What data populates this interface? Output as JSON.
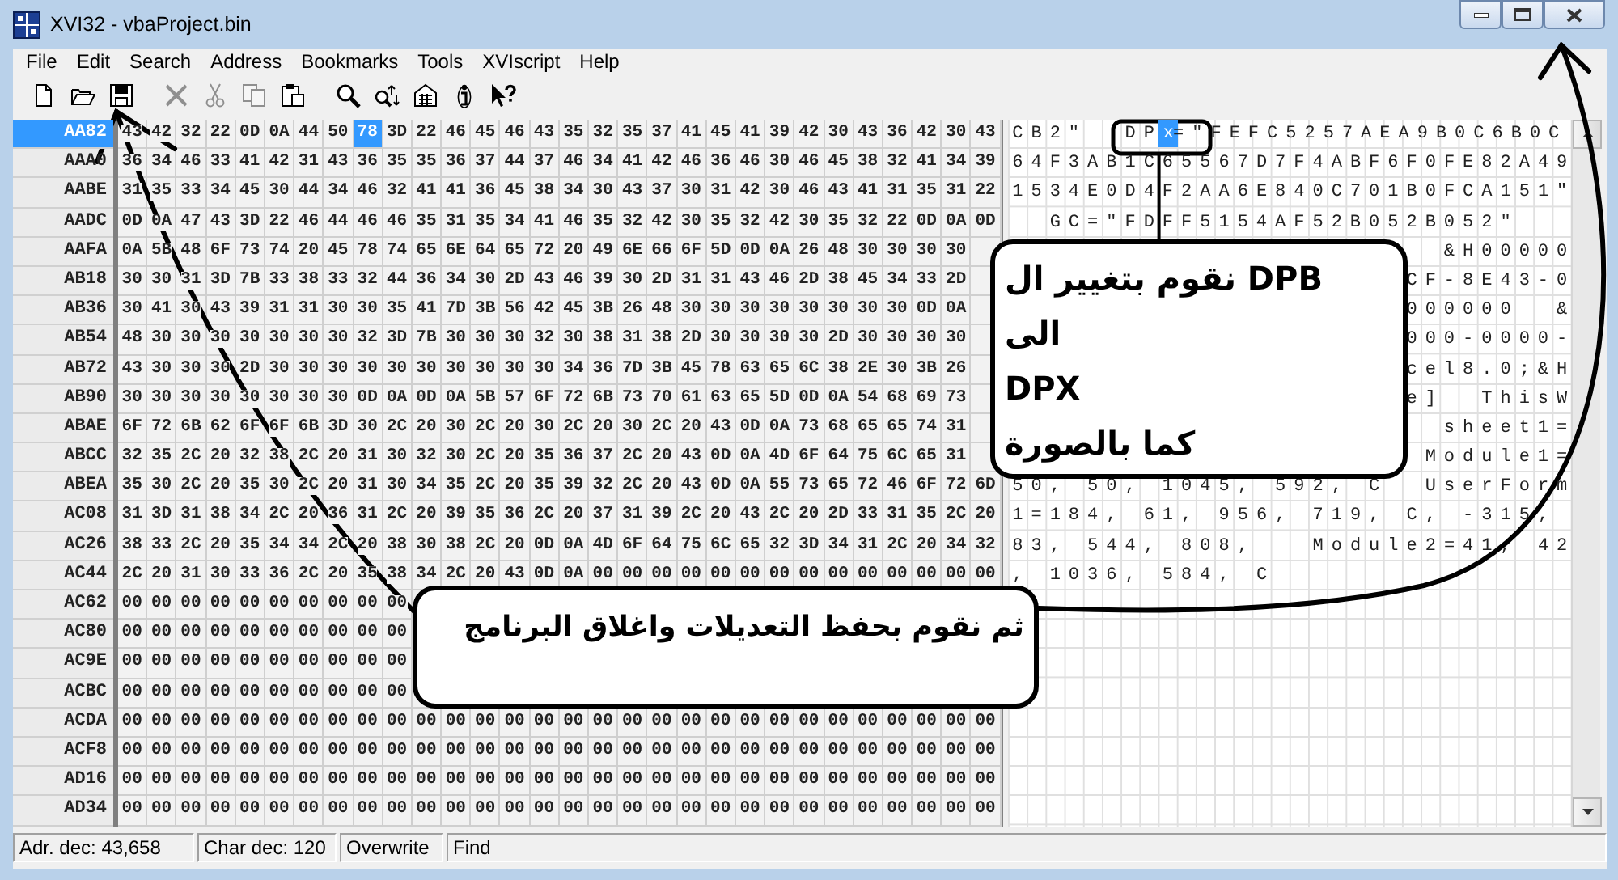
{
  "window": {
    "title": "XVI32 - vbaProject.bin"
  },
  "menu": [
    "File",
    "Edit",
    "Search",
    "Address",
    "Bookmarks",
    "Tools",
    "XVIscript",
    "Help"
  ],
  "toolbar": [
    {
      "kind": "new",
      "disabled": false
    },
    {
      "kind": "open",
      "disabled": false
    },
    {
      "kind": "save",
      "disabled": false
    },
    {
      "kind": "delete",
      "disabled": true
    },
    {
      "kind": "cut",
      "disabled": true
    },
    {
      "kind": "copy",
      "disabled": true
    },
    {
      "kind": "paste",
      "disabled": false
    },
    {
      "kind": "find",
      "disabled": false
    },
    {
      "kind": "replace",
      "disabled": false
    },
    {
      "kind": "properties",
      "disabled": false
    },
    {
      "kind": "info",
      "disabled": false
    },
    {
      "kind": "help",
      "disabled": false
    }
  ],
  "rows": [
    {
      "address": "AA82",
      "selected": true,
      "bytes": [
        "43",
        "42",
        "32",
        "22",
        "0D",
        "0A",
        "44",
        "50"
      ],
      "cursor": {
        "hex": "78",
        "char": "x"
      },
      "bytes_after": [
        "3D",
        "22",
        "46",
        "45",
        "46",
        "43",
        "35",
        "32",
        "35",
        "37",
        "41",
        "45",
        "41",
        "39",
        "42",
        "30",
        "43",
        "36",
        "42",
        "30",
        "43"
      ],
      "text": "CB2\"  DP",
      "text_after": "=\"FEFC5257AEA9B0C6B0C"
    },
    {
      "address": "AAA0",
      "selected": false,
      "bytes": [
        "36",
        "34",
        "46",
        "33",
        "41",
        "42",
        "31",
        "43",
        "36",
        "35",
        "35",
        "36",
        "37",
        "44",
        "37",
        "46",
        "34",
        "41",
        "42",
        "46",
        "36",
        "46",
        "30",
        "46",
        "45",
        "38",
        "32",
        "41",
        "34",
        "39"
      ],
      "text": "64F3AB1C65567D7F4ABF6F0FE82A49"
    },
    {
      "address": "AABE",
      "selected": false,
      "bytes": [
        "31",
        "35",
        "33",
        "34",
        "45",
        "30",
        "44",
        "34",
        "46",
        "32",
        "41",
        "41",
        "36",
        "45",
        "38",
        "34",
        "30",
        "43",
        "37",
        "30",
        "31",
        "42",
        "30",
        "46",
        "43",
        "41",
        "31",
        "35",
        "31",
        "22"
      ],
      "text": "1534E0D4F2AA6E840C701B0FCA151\""
    },
    {
      "address": "AADC",
      "selected": false,
      "bytes": [
        "0D",
        "0A",
        "47",
        "43",
        "3D",
        "22",
        "46",
        "44",
        "46",
        "46",
        "35",
        "31",
        "35",
        "34",
        "41",
        "46",
        "35",
        "32",
        "42",
        "30",
        "35",
        "32",
        "42",
        "30",
        "35",
        "32",
        "22",
        "0D",
        "0A",
        "0D"
      ],
      "text": "  GC=\"FDFF5154AF52B052B052\"   "
    },
    {
      "address": "AAFA",
      "selected": false,
      "bytes": [
        "0A",
        "5B",
        "48",
        "6F",
        "73",
        "74",
        "20",
        "45",
        "78",
        "74",
        "65",
        "6E",
        "64",
        "65",
        "72",
        "20",
        "49",
        "6E",
        "66",
        "6F",
        "5D",
        "0D",
        "0A",
        "26",
        "48",
        "30",
        "30",
        "30",
        "30"
      ],
      "text": "                       &H00000"
    },
    {
      "address": "AB18",
      "selected": false,
      "bytes": [
        "30",
        "30",
        "31",
        "3D",
        "7B",
        "33",
        "38",
        "33",
        "32",
        "44",
        "36",
        "34",
        "30",
        "2D",
        "43",
        "46",
        "39",
        "30",
        "2D",
        "31",
        "31",
        "43",
        "46",
        "2D",
        "38",
        "45",
        "34",
        "33",
        "2D"
      ],
      "text": "                     CF-8E43-0"
    },
    {
      "address": "AB36",
      "selected": false,
      "bytes": [
        "30",
        "41",
        "30",
        "43",
        "39",
        "31",
        "31",
        "30",
        "30",
        "35",
        "41",
        "7D",
        "3B",
        "56",
        "42",
        "45",
        "3B",
        "26",
        "48",
        "30",
        "30",
        "30",
        "30",
        "30",
        "30",
        "30",
        "30",
        "0D",
        "0A"
      ],
      "text": "                     000000  &"
    },
    {
      "address": "AB54",
      "selected": false,
      "bytes": [
        "48",
        "30",
        "30",
        "30",
        "30",
        "30",
        "30",
        "30",
        "32",
        "3D",
        "7B",
        "30",
        "30",
        "30",
        "32",
        "30",
        "38",
        "31",
        "38",
        "2D",
        "30",
        "30",
        "30",
        "30",
        "2D",
        "30",
        "30",
        "30",
        "30"
      ],
      "text": "                     000-0000-"
    },
    {
      "address": "AB72",
      "selected": false,
      "bytes": [
        "43",
        "30",
        "30",
        "30",
        "2D",
        "30",
        "30",
        "30",
        "30",
        "30",
        "30",
        "30",
        "30",
        "30",
        "30",
        "34",
        "36",
        "7D",
        "3B",
        "45",
        "78",
        "63",
        "65",
        "6C",
        "38",
        "2E",
        "30",
        "3B",
        "26"
      ],
      "text": "                     cel8.0;&H"
    },
    {
      "address": "AB90",
      "selected": false,
      "bytes": [
        "30",
        "30",
        "30",
        "30",
        "30",
        "30",
        "30",
        "30",
        "0D",
        "0A",
        "0D",
        "0A",
        "5B",
        "57",
        "6F",
        "72",
        "6B",
        "73",
        "70",
        "61",
        "63",
        "65",
        "5D",
        "0D",
        "0A",
        "54",
        "68",
        "69",
        "73"
      ],
      "text": "                     e]  ThisW"
    },
    {
      "address": "ABAE",
      "selected": false,
      "bytes": [
        "6F",
        "72",
        "6B",
        "62",
        "6F",
        "6F",
        "6B",
        "3D",
        "30",
        "2C",
        "20",
        "30",
        "2C",
        "20",
        "30",
        "2C",
        "20",
        "30",
        "2C",
        "20",
        "43",
        "0D",
        "0A",
        "73",
        "68",
        "65",
        "65",
        "74",
        "31"
      ],
      "text": "                       sheet1="
    },
    {
      "address": "ABCC",
      "selected": false,
      "bytes": [
        "32",
        "35",
        "2C",
        "20",
        "32",
        "38",
        "2C",
        "20",
        "31",
        "30",
        "32",
        "30",
        "2C",
        "20",
        "35",
        "36",
        "37",
        "2C",
        "20",
        "43",
        "0D",
        "0A",
        "4D",
        "6F",
        "64",
        "75",
        "6C",
        "65",
        "31"
      ],
      "text": "                      Module1="
    },
    {
      "address": "ABEA",
      "selected": false,
      "bytes": [
        "35",
        "30",
        "2C",
        "20",
        "35",
        "30",
        "2C",
        "20",
        "31",
        "30",
        "34",
        "35",
        "2C",
        "20",
        "35",
        "39",
        "32",
        "2C",
        "20",
        "43",
        "0D",
        "0A",
        "55",
        "73",
        "65",
        "72",
        "46",
        "6F",
        "72",
        "6D"
      ],
      "text": "50, 50, 1045, 592, C  UserForm"
    },
    {
      "address": "AC08",
      "selected": false,
      "bytes": [
        "31",
        "3D",
        "31",
        "38",
        "34",
        "2C",
        "20",
        "36",
        "31",
        "2C",
        "20",
        "39",
        "35",
        "36",
        "2C",
        "20",
        "37",
        "31",
        "39",
        "2C",
        "20",
        "43",
        "2C",
        "20",
        "2D",
        "33",
        "31",
        "35",
        "2C",
        "20"
      ],
      "text": "1=184, 61, 956, 719, C, -315, "
    },
    {
      "address": "AC26",
      "selected": false,
      "bytes": [
        "38",
        "33",
        "2C",
        "20",
        "35",
        "34",
        "34",
        "2C",
        "20",
        "38",
        "30",
        "38",
        "2C",
        "20",
        "0D",
        "0A",
        "4D",
        "6F",
        "64",
        "75",
        "6C",
        "65",
        "32",
        "3D",
        "34",
        "31",
        "2C",
        "20",
        "34",
        "32"
      ],
      "text": "83, 544, 808,   Module2=41, 42"
    },
    {
      "address": "AC44",
      "selected": false,
      "bytes": [
        "2C",
        "20",
        "31",
        "30",
        "33",
        "36",
        "2C",
        "20",
        "35",
        "38",
        "34",
        "2C",
        "20",
        "43",
        "0D",
        "0A",
        "00",
        "00",
        "00",
        "00",
        "00",
        "00",
        "00",
        "00",
        "00",
        "00",
        "00",
        "00",
        "00",
        "00"
      ],
      "text": ", 1036, 584, C"
    },
    {
      "address": "AC62",
      "selected": false,
      "bytes": [
        "00",
        "00",
        "00",
        "00",
        "00",
        "00",
        "00",
        "00",
        "00",
        "00"
      ]
    },
    {
      "address": "AC80",
      "selected": false,
      "bytes": [
        "00",
        "00",
        "00",
        "00",
        "00",
        "00",
        "00",
        "00",
        "00",
        "00"
      ]
    },
    {
      "address": "AC9E",
      "selected": false,
      "bytes": [
        "00",
        "00",
        "00",
        "00",
        "00",
        "00",
        "00",
        "00",
        "00",
        "00"
      ]
    },
    {
      "address": "ACBC",
      "selected": false,
      "bytes": [
        "00",
        "00",
        "00",
        "00",
        "00",
        "00",
        "00",
        "00",
        "00",
        "00"
      ]
    },
    {
      "address": "ACDA",
      "selected": false,
      "bytes": [
        "00",
        "00",
        "00",
        "00",
        "00",
        "00",
        "00",
        "00",
        "00",
        "00",
        "00",
        "00",
        "00",
        "00",
        "00",
        "00",
        "00",
        "00",
        "00",
        "00",
        "00",
        "00",
        "00",
        "00",
        "00",
        "00",
        "00",
        "00",
        "00",
        "00"
      ]
    },
    {
      "address": "ACF8",
      "selected": false,
      "bytes": [
        "00",
        "00",
        "00",
        "00",
        "00",
        "00",
        "00",
        "00",
        "00",
        "00",
        "00",
        "00",
        "00",
        "00",
        "00",
        "00",
        "00",
        "00",
        "00",
        "00",
        "00",
        "00",
        "00",
        "00",
        "00",
        "00",
        "00",
        "00",
        "00",
        "00"
      ]
    },
    {
      "address": "AD16",
      "selected": false,
      "bytes": [
        "00",
        "00",
        "00",
        "00",
        "00",
        "00",
        "00",
        "00",
        "00",
        "00",
        "00",
        "00",
        "00",
        "00",
        "00",
        "00",
        "00",
        "00",
        "00",
        "00",
        "00",
        "00",
        "00",
        "00",
        "00",
        "00",
        "00",
        "00",
        "00",
        "00"
      ]
    },
    {
      "address": "AD34",
      "selected": false,
      "bytes": [
        "00",
        "00",
        "00",
        "00",
        "00",
        "00",
        "00",
        "00",
        "00",
        "00",
        "00",
        "00",
        "00",
        "00",
        "00",
        "00",
        "00",
        "00",
        "00",
        "00",
        "00",
        "00",
        "00",
        "00",
        "00",
        "00",
        "00",
        "00",
        "00",
        "00"
      ]
    }
  ],
  "status_bar": [
    "Adr. dec: 43,658",
    "Char dec: 120",
    "Overwrite",
    "Find"
  ],
  "callouts": [
    {
      "kind": "upper",
      "lines": [
        "نقوم بتغيير ال DPB",
        "الى",
        "DPX",
        "كما بالصورة"
      ]
    },
    {
      "kind": "lower",
      "lines": [
        "ثم نقوم بحفظ التعديلات واغلاق البرنامج"
      ]
    }
  ]
}
